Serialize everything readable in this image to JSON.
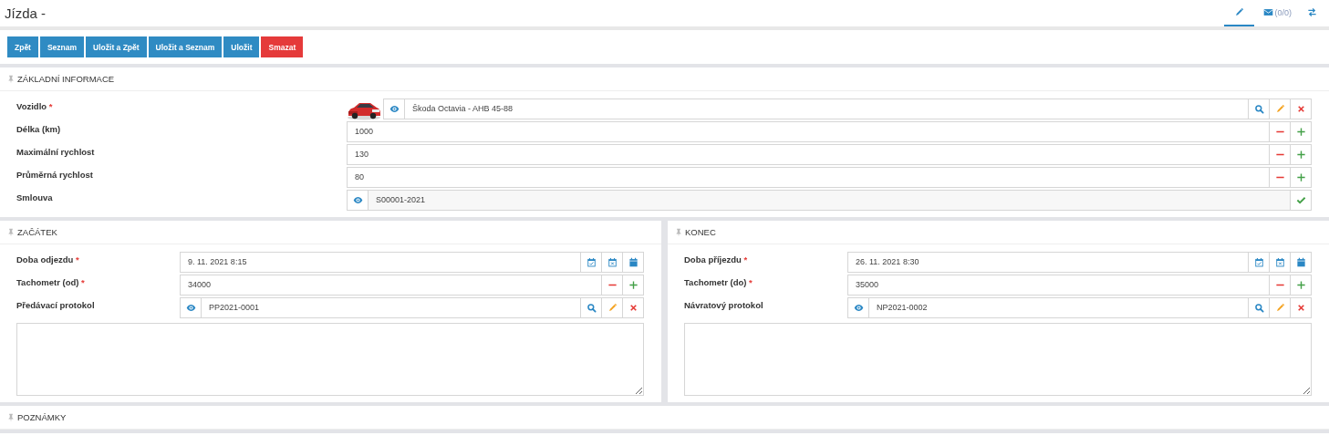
{
  "window": {
    "title": "Jízda -"
  },
  "tabs": [
    {
      "kind": "edit",
      "selected": true
    },
    {
      "kind": "mail",
      "label": "(0/0)",
      "selected": false
    },
    {
      "kind": "swap",
      "selected": false
    }
  ],
  "buttons": [
    {
      "label": "Zpět",
      "kind": "primary"
    },
    {
      "label": "Seznam",
      "kind": "primary"
    },
    {
      "label": "Uložit a Zpět",
      "kind": "primary"
    },
    {
      "label": "Uložit a Seznam",
      "kind": "primary"
    },
    {
      "label": "Uložit",
      "kind": "primary"
    },
    {
      "label": "Smazat",
      "kind": "danger"
    }
  ],
  "sections": [
    {
      "kind": "panel",
      "title": "ZÁKLADNÍ INFORMACE",
      "fields": [
        {
          "label": "Vozidlo",
          "required_mark": "*",
          "kind": "lookup",
          "thumbnail": true,
          "value": "Škoda  Octavia  - AHB 45-88"
        },
        {
          "label": "Délka (km)",
          "kind": "number",
          "value": "1000"
        },
        {
          "label": "Maximální rychlost",
          "kind": "number",
          "value": "130"
        },
        {
          "label": "Průměrná rychlost",
          "kind": "number",
          "value": "80"
        },
        {
          "label": "Smlouva",
          "kind": "reference",
          "value": "S00001-2021"
        }
      ]
    },
    {
      "kind": "columns",
      "panels": [
        {
          "title": "ZAČÁTEK",
          "text_area": true,
          "fields": [
            {
              "label": "Doba odjezdu",
              "required_mark": "*",
              "kind": "date",
              "value": "9. 11. 2021 8:15"
            },
            {
              "label": "Tachometr (od)",
              "required_mark": "*",
              "kind": "number",
              "value": "34000"
            },
            {
              "label": "Předávací protokol",
              "kind": "lookup",
              "value": "PP2021-0001"
            }
          ]
        },
        {
          "title": "KONEC",
          "text_area": true,
          "fields": [
            {
              "label": "Doba příjezdu",
              "required_mark": "*",
              "kind": "date",
              "value": "26. 11. 2021 8:30"
            },
            {
              "label": "Tachometr (do)",
              "required_mark": "*",
              "kind": "number",
              "value": "35000"
            },
            {
              "label": "Návratový protokol",
              "kind": "lookup",
              "value": "NP2021-0002"
            }
          ]
        }
      ]
    },
    {
      "kind": "panel",
      "title": "POZNÁMKY"
    }
  ]
}
